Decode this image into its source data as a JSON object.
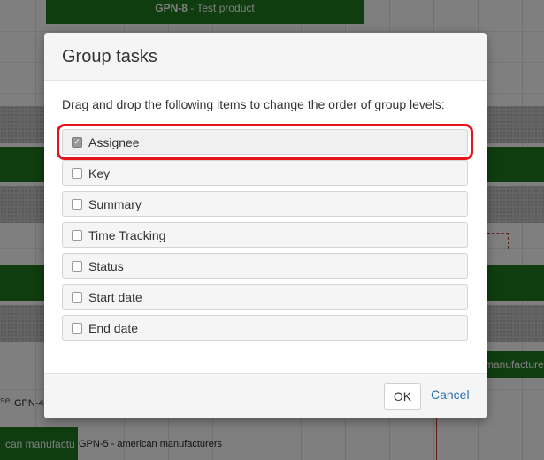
{
  "background": {
    "top_task_id": "GPN-8",
    "top_task_name": " - Test product",
    "right_task_label": "manufacturer",
    "left_task_label": "can manufactu",
    "row_label_1": "GPN-4",
    "row_label_2": "GPN-5 - american manufacturers",
    "stray_text": "se"
  },
  "dialog": {
    "title": "Group tasks",
    "description": "Drag and drop the following items to change the order of group levels:",
    "items": [
      {
        "label": "Assignee",
        "checked": true
      },
      {
        "label": "Key",
        "checked": false
      },
      {
        "label": "Summary",
        "checked": false
      },
      {
        "label": "Time Tracking",
        "checked": false
      },
      {
        "label": "Status",
        "checked": false
      },
      {
        "label": "Start date",
        "checked": false
      },
      {
        "label": "End date",
        "checked": false
      }
    ],
    "ok_label": "OK",
    "cancel_label": "Cancel"
  },
  "colors": {
    "task_bar": "#1e7a1e",
    "highlight": "#e8141c",
    "link": "#2a6fb0"
  }
}
